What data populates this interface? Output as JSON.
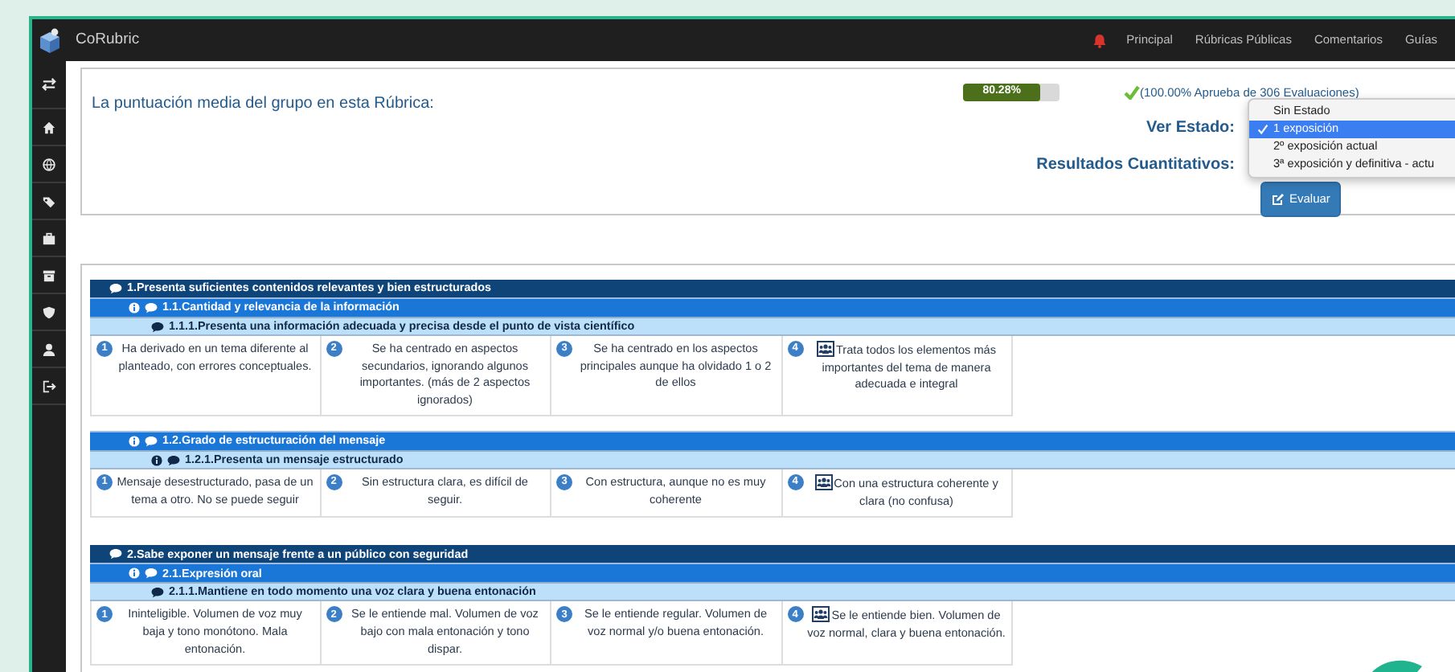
{
  "app": {
    "name": "CoRubric"
  },
  "nav": [
    {
      "label": "Principal"
    },
    {
      "label": "Rúbricas Públicas"
    },
    {
      "label": "Comentarios"
    },
    {
      "label": "Guías"
    }
  ],
  "summary": {
    "label": "La puntuación media del grupo en esta Rúbrica:",
    "score": "80.28%",
    "level": 0.8028,
    "approval": "(100.00% Aprueba de 306 Evaluaciones)",
    "state_label": "Ver Estado:",
    "quant_label": "Resultados Cuantitativos:",
    "evaluate_button": "Evaluar"
  },
  "state_menu": [
    {
      "label": "Sin Estado",
      "selected": false
    },
    {
      "label": "1 exposición",
      "selected": true
    },
    {
      "label": "2º exposición actual",
      "selected": false
    },
    {
      "label": "3ª exposición y definitiva - actu",
      "selected": false
    }
  ],
  "criteria": [
    {
      "title": "1.Presenta suficientes contenidos relevantes y bien estructurados",
      "subcriteria": [
        {
          "title": "1.1.Cantidad y relevancia de la información",
          "indicators": [
            {
              "title": "1.1.1.Presenta una información adecuada y precisa desde el punto de vista científico",
              "info": false,
              "levels": [
                {
                  "number": "1",
                  "text": "Ha derivado en un tema diferente al planteado, con errores conceptuales.",
                  "group_icon": false
                },
                {
                  "number": "2",
                  "text": "Se ha centrado en aspectos secundarios, ignorando algunos importantes. (más de 2 aspectos ignorados)",
                  "group_icon": false
                },
                {
                  "number": "3",
                  "text": "Se ha centrado en los aspectos principales aunque ha olvidado 1 o 2 de ellos",
                  "group_icon": false
                },
                {
                  "number": "4",
                  "text": "Trata todos los elementos más importantes del tema de manera adecuada e integral",
                  "group_icon": true
                }
              ]
            }
          ]
        },
        {
          "title": "1.2.Grado de estructuración del mensaje",
          "indicators": [
            {
              "title": "1.2.1.Presenta un mensaje estructurado",
              "info": true,
              "levels": [
                {
                  "number": "1",
                  "text": "Mensaje desestructurado, pasa de un tema a otro. No se puede seguir",
                  "group_icon": false
                },
                {
                  "number": "2",
                  "text": "Sin estructura clara, es difícil de seguir.",
                  "group_icon": false
                },
                {
                  "number": "3",
                  "text": "Con estructura, aunque no es muy coherente",
                  "group_icon": false
                },
                {
                  "number": "4",
                  "text": "Con una estructura coherente y clara (no confusa)",
                  "group_icon": true
                }
              ]
            }
          ]
        }
      ]
    },
    {
      "title": "2.Sabe exponer un mensaje frente a un público con seguridad",
      "subcriteria": [
        {
          "title": "2.1.Expresión oral",
          "indicators": [
            {
              "title": "2.1.1.Mantiene en todo momento una voz clara y buena entonación",
              "info": false,
              "levels": [
                {
                  "number": "1",
                  "text": "Ininteligible. Volumen de voz muy baja y tono monótono. Mala entonación.",
                  "group_icon": false
                },
                {
                  "number": "2",
                  "text": "Se le entiende mal. Volumen de voz bajo con mala entonación y tono dispar.",
                  "group_icon": false
                },
                {
                  "number": "3",
                  "text": "Se le entiende regular. Volumen de voz normal y/o buena entonación.",
                  "group_icon": false
                },
                {
                  "number": "4",
                  "text": "Se le entiende bien. Volumen de voz normal, clara y buena entonación.",
                  "group_icon": true
                }
              ]
            }
          ]
        }
      ]
    }
  ]
}
